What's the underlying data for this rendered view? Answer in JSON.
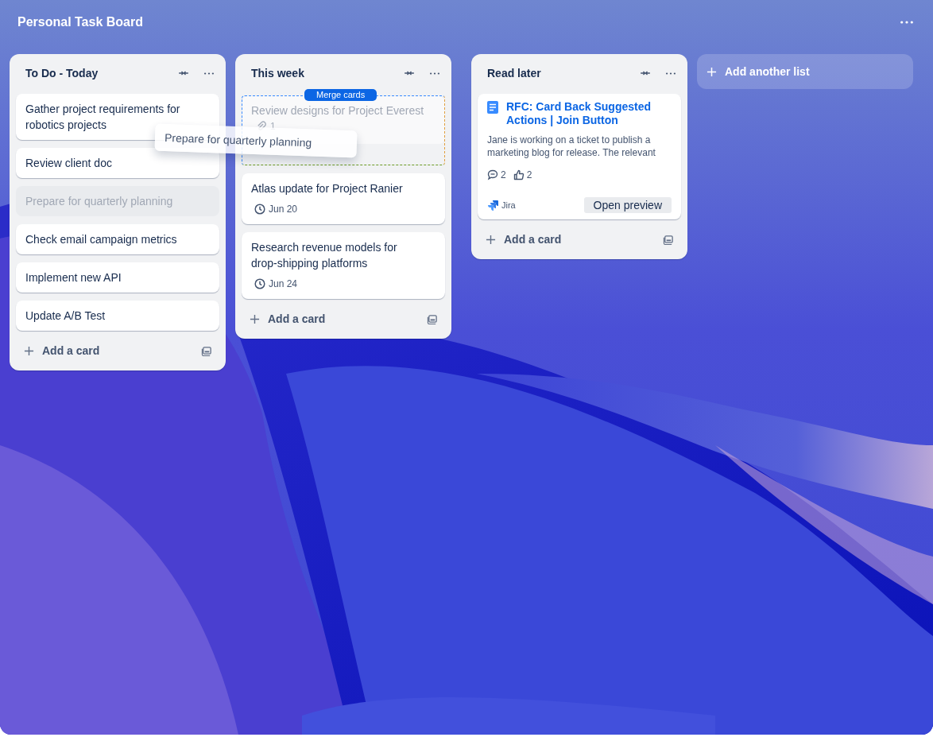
{
  "board": {
    "title": "Personal Task Board"
  },
  "lists": [
    {
      "title": "To Do - Today",
      "cards": [
        {
          "kind": "text",
          "title": "Gather project requirements for robotics projects"
        },
        {
          "kind": "text",
          "title": "Review client doc"
        },
        {
          "kind": "placeholder",
          "title": "Prepare for quarterly planning"
        },
        {
          "kind": "text",
          "title": "Check email campaign metrics"
        },
        {
          "kind": "text",
          "title": "Implement new API"
        },
        {
          "kind": "text",
          "title": "Update A/B Test"
        }
      ],
      "add_label": "Add a card"
    },
    {
      "title": "This week",
      "cards": [
        {
          "kind": "merge-target",
          "badge": "Merge cards",
          "title": "Review designs for Project Everest",
          "attachments": "1"
        },
        {
          "kind": "dated",
          "title": "Atlas update for Project Ranier",
          "date": "Jun 20"
        },
        {
          "kind": "dated",
          "title": "Research revenue models for drop-shipping platforms",
          "date": "Jun 24"
        }
      ],
      "add_label": "Add a card"
    },
    {
      "title": "Read later",
      "cards": [
        {
          "kind": "link",
          "title": "RFC: Card Back Suggested Actions | Join Button",
          "description": "Jane is working on a ticket to publish a marketing blog for release. The relevant",
          "comments": "2",
          "likes": "2",
          "source": "Jira",
          "action": "Open preview"
        }
      ],
      "add_label": "Add a card"
    }
  ],
  "add_list": {
    "label": "Add another list"
  },
  "dragging_card": {
    "title": "Prepare for quarterly planning"
  }
}
